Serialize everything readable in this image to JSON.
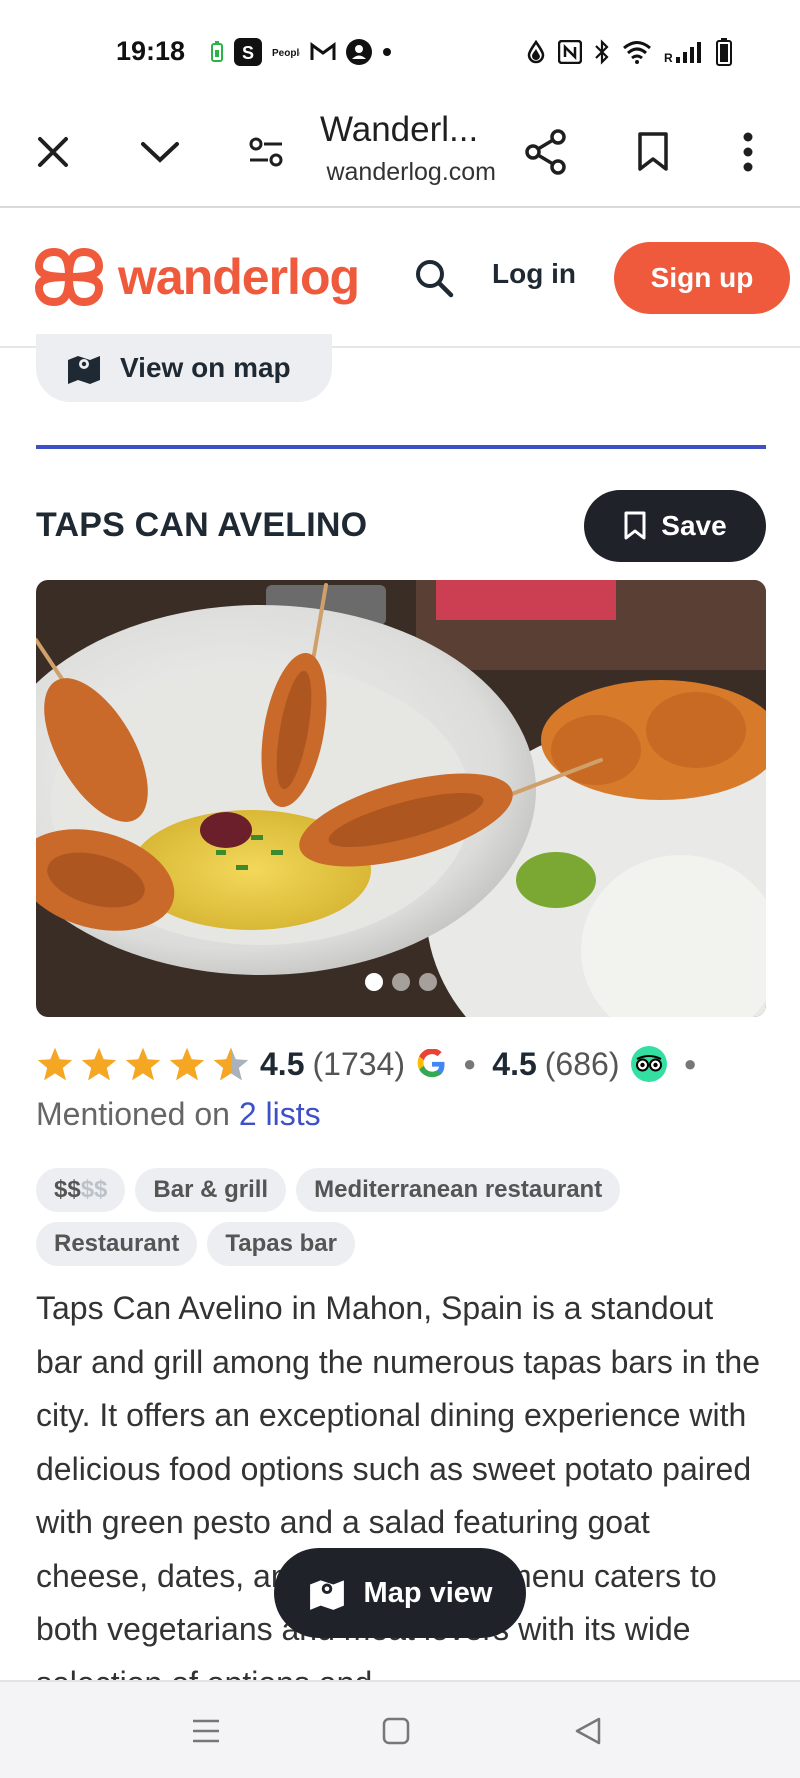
{
  "status_bar": {
    "time": "19:18",
    "left_icons": [
      "battery-saver-icon",
      "s-app-icon",
      "people-app-icon",
      "gmail-icon",
      "account-icon",
      "dot-icon"
    ],
    "right_icons": [
      "data-saver-icon",
      "nfc-icon",
      "bluetooth-icon",
      "wifi-icon",
      "signal-icon",
      "battery-icon"
    ],
    "signal_label": "R"
  },
  "browser": {
    "title": "Wanderl...",
    "url": "wanderlog.com",
    "icons": [
      "close-icon",
      "chevron-down-icon",
      "site-settings-icon",
      "share-icon",
      "bookmark-icon",
      "more-vert-icon"
    ]
  },
  "site_header": {
    "logo_text": "wanderlog",
    "login_label": "Log in",
    "signup_label": "Sign up",
    "brand_color": "#f05a3c"
  },
  "view_on_map_label": "View on map",
  "place": {
    "title": "TAPS CAN AVELINO",
    "save_label": "Save",
    "photo_count": 3,
    "photo_active_index": 0
  },
  "ratings": {
    "stars": 4.5,
    "google_rating": "4.5",
    "google_count": "(1734)",
    "tripadvisor_rating": "4.5",
    "tripadvisor_count": "(686)"
  },
  "mentioned": {
    "prefix": "Mentioned on",
    "link": "2 lists"
  },
  "tags": {
    "price_active": "$$",
    "price_inactive": "$$",
    "items": [
      "Bar & grill",
      "Mediterranean restaurant",
      "Restaurant",
      "Tapas bar"
    ]
  },
  "description": "Taps Can Avelino in Mahon, Spain is a standout bar and grill among the numerous tapas bars in the city. It offers an exceptional dining experience with delicious food options such as sweet potato paired with green pesto and a salad featuring goat cheese, dates, and walnuts. The menu caters to both vegetarians and meat lovers with its wide selection of options and",
  "map_view_label": "Map view",
  "accent_color": "#3d50c7"
}
